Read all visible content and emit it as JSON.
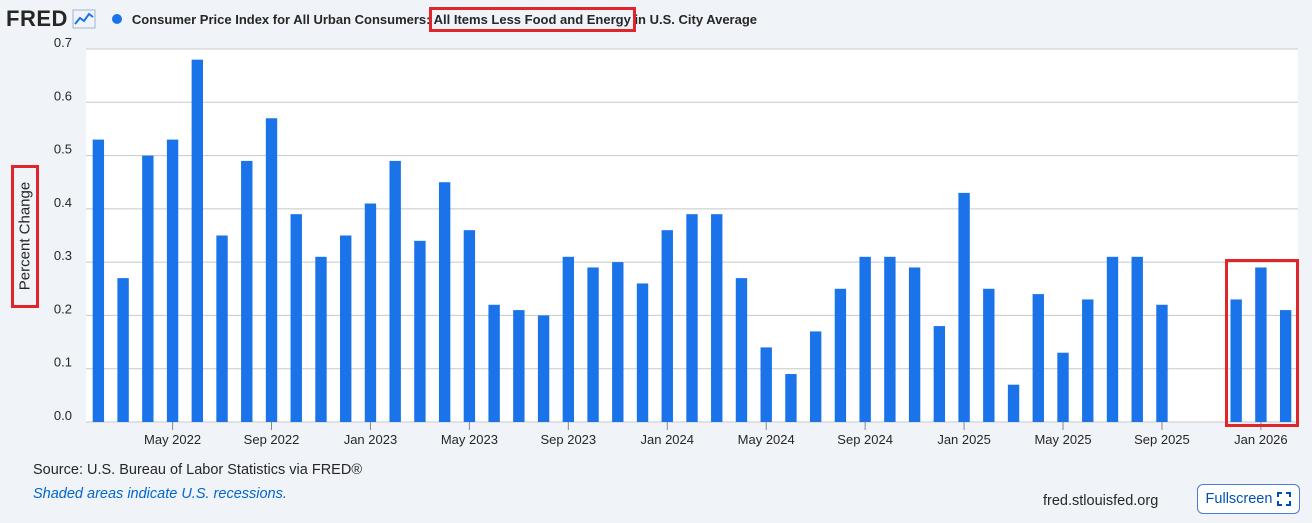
{
  "header": {
    "logo": "FRED",
    "series_title_prefix": "Consumer Price Index for All Urban Consumers: ",
    "series_title_highlight": "All Items Less Food and Energy",
    "series_title_suffix": " in U.S. City Average"
  },
  "colors": {
    "bar": "#1a73e8",
    "grid": "#c8c8c8",
    "highlight_box": "#e0252b",
    "plot_bg": "#ffffff",
    "page_bg": "#f0f4f8"
  },
  "chart_data": {
    "type": "bar",
    "title": "Consumer Price Index for All Urban Consumers: All Items Less Food and Energy in U.S. City Average",
    "ylabel": "Percent Change",
    "xlabel": "",
    "ylim": [
      0,
      0.7
    ],
    "yticks": [
      "0.0",
      "0.1",
      "0.2",
      "0.3",
      "0.4",
      "0.5",
      "0.6",
      "0.7"
    ],
    "grid": true,
    "x": [
      "2022-02",
      "2022-03",
      "2022-04",
      "2022-05",
      "2022-06",
      "2022-07",
      "2022-08",
      "2022-09",
      "2022-10",
      "2022-11",
      "2022-12",
      "2023-01",
      "2023-02",
      "2023-03",
      "2023-04",
      "2023-05",
      "2023-06",
      "2023-07",
      "2023-08",
      "2023-09",
      "2023-10",
      "2023-11",
      "2023-12",
      "2024-01",
      "2024-02",
      "2024-03",
      "2024-04",
      "2024-05",
      "2024-06",
      "2024-07",
      "2024-08",
      "2024-09",
      "2024-10",
      "2024-11",
      "2024-12",
      "2025-01",
      "2025-02",
      "2025-03",
      "2025-04",
      "2025-05",
      "2025-06",
      "2025-07",
      "2025-08",
      "2025-09",
      "2025-10",
      "2025-11",
      "2025-12",
      "2026-01",
      "2026-02"
    ],
    "values": [
      0.53,
      0.27,
      0.5,
      0.53,
      0.68,
      0.35,
      0.49,
      0.57,
      0.39,
      0.31,
      0.35,
      0.41,
      0.49,
      0.34,
      0.45,
      0.36,
      0.22,
      0.21,
      0.2,
      0.31,
      0.29,
      0.3,
      0.26,
      0.36,
      0.39,
      0.39,
      0.27,
      0.14,
      0.09,
      0.17,
      0.25,
      0.31,
      0.31,
      0.29,
      0.18,
      0.43,
      0.25,
      0.07,
      0.24,
      0.13,
      0.23,
      0.31,
      0.31,
      0.22,
      null,
      null,
      0.23,
      0.29,
      0.21
    ],
    "xtick_labels": [
      {
        "x": "2022-05",
        "label": "May 2022"
      },
      {
        "x": "2022-09",
        "label": "Sep 2022"
      },
      {
        "x": "2023-01",
        "label": "Jan 2023"
      },
      {
        "x": "2023-05",
        "label": "May 2023"
      },
      {
        "x": "2023-09",
        "label": "Sep 2023"
      },
      {
        "x": "2024-01",
        "label": "Jan 2024"
      },
      {
        "x": "2024-05",
        "label": "May 2024"
      },
      {
        "x": "2024-09",
        "label": "Sep 2024"
      },
      {
        "x": "2025-01",
        "label": "Jan 2025"
      },
      {
        "x": "2025-05",
        "label": "May 2025"
      },
      {
        "x": "2025-09",
        "label": "Sep 2025"
      },
      {
        "x": "2026-01",
        "label": "Jan 2026"
      }
    ]
  },
  "footer": {
    "source": "Source: U.S. Bureau of Labor Statistics via FRED®",
    "recession_note": "Shaded areas indicate U.S. recessions.",
    "site": "fred.stlouisfed.org",
    "fullscreen_label": "Fullscreen"
  }
}
